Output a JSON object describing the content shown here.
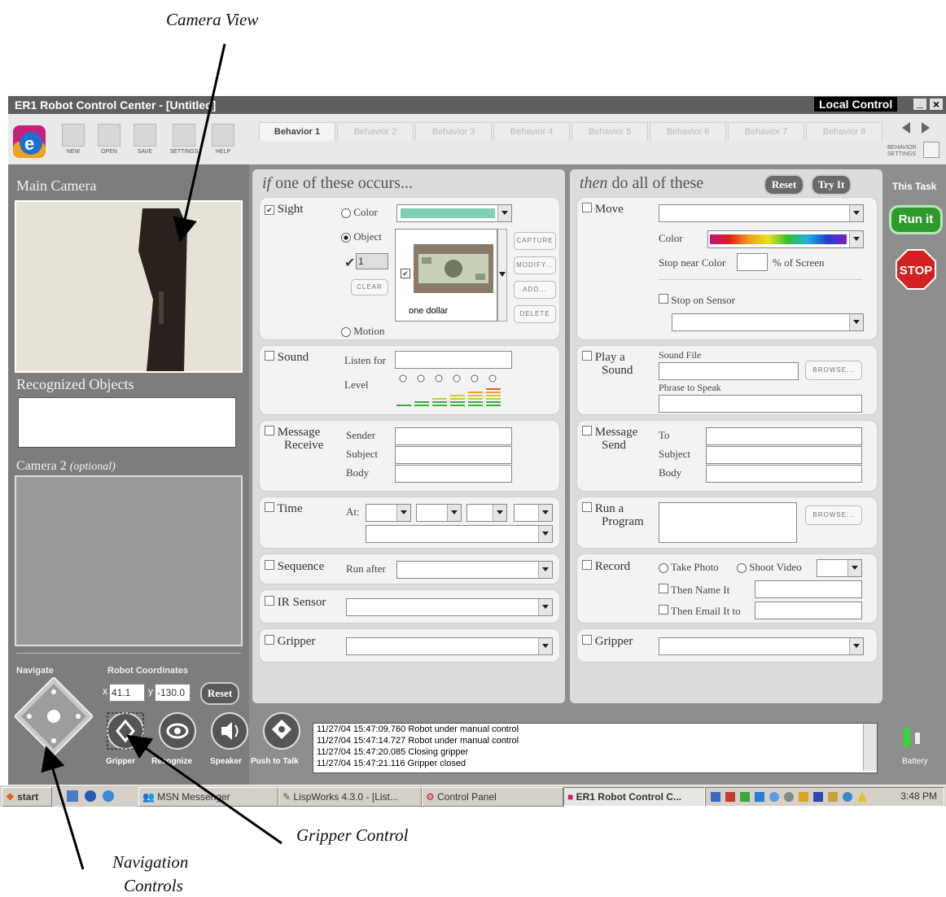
{
  "annotations": {
    "camera_view": "Camera View",
    "gripper_control": "Gripper Control",
    "navigation_line1": "Navigation",
    "navigation_line2": "Controls"
  },
  "window": {
    "title": "ER1 Robot Control Center - [Untitled]",
    "mode": "Local Control",
    "minimize": "_",
    "close": "×"
  },
  "toolbar": {
    "new": "NEW",
    "open": "OPEN",
    "save": "SAVE",
    "settings": "SETTINGS",
    "help": "HELP",
    "behavior_settings": "BEHAVIOR SETTINGS"
  },
  "tabs": [
    "Behavior 1",
    "Behavior 2",
    "Behavior 3",
    "Behavior 4",
    "Behavior 5",
    "Behavior 6",
    "Behavior 7",
    "Behavior 8"
  ],
  "left": {
    "main_camera": "Main Camera",
    "recognized_objects": "Recognized Objects",
    "camera2": "Camera 2",
    "camera2_optional": "(optional)",
    "navigate": "Navigate",
    "robot_coordinates": "Robot Coordinates",
    "x_label": "x",
    "x_value": "41.1",
    "y_label": "y",
    "y_value": "-130.0",
    "reset": "Reset"
  },
  "controls": {
    "gripper": "Gripper",
    "recognize": "Recognize",
    "speaker": "Speaker",
    "push_to_talk": "Push to Talk"
  },
  "log": [
    "11/27/04 15:47:09.760 Robot under manual control",
    "11/27/04 15:47:14.727 Robot under manual control",
    "11/27/04 15:47:20.085 Closing gripper",
    "11/27/04 15:47:21.116 Gripper closed"
  ],
  "battery": "Battery",
  "if_panel": {
    "if_word": "if",
    "heading": "one of these occurs...",
    "sight": "Sight",
    "color": "Color",
    "object": "Object",
    "count": "1",
    "clear": "CLEAR",
    "capture": "CAPTURE",
    "modify": "MODIFY...",
    "add": "ADD...",
    "delete": "DELETE",
    "object_name": "one dollar",
    "motion": "Motion",
    "sound": "Sound",
    "listen_for": "Listen for",
    "level": "Level",
    "message_receive_1": "Message",
    "message_receive_2": "Receive",
    "sender": "Sender",
    "subject": "Subject",
    "body": "Body",
    "time": "Time",
    "at": "At:",
    "sequence": "Sequence",
    "run_after": "Run after",
    "ir_sensor": "IR Sensor",
    "gripper": "Gripper"
  },
  "then_panel": {
    "then_word": "then",
    "heading": "do all of these",
    "reset": "Reset",
    "try_it": "Try It",
    "move": "Move",
    "color": "Color",
    "stop_near_color": "Stop near Color",
    "pct_screen": "% of Screen",
    "stop_on_sensor": "Stop on Sensor",
    "play_sound_1": "Play a",
    "play_sound_2": "Sound",
    "sound_file": "Sound File",
    "browse": "BROWSE...",
    "phrase_to_speak": "Phrase to Speak",
    "message_send_1": "Message",
    "message_send_2": "Send",
    "to": "To",
    "subject": "Subject",
    "body": "Body",
    "run_program_1": "Run a",
    "run_program_2": "Program",
    "record": "Record",
    "take_photo": "Take Photo",
    "shoot_video": "Shoot Video",
    "then_name_it": "Then Name It",
    "then_email_it_to": "Then Email It to",
    "gripper": "Gripper"
  },
  "task": {
    "this_task": "This Task",
    "run_it": "Run it",
    "stop": "STOP"
  },
  "taskbar": {
    "start": "start",
    "msn": "MSN Messenger",
    "lispworks": "LispWorks 4.3.0 - [List...",
    "control_panel": "Control Panel",
    "er1": "ER1 Robot Control C...",
    "clock": "3:48 PM"
  },
  "colors": {
    "run_green": "#2e9a2e",
    "stop_red": "#d42020",
    "color_swatch": "#7fd0b0"
  }
}
